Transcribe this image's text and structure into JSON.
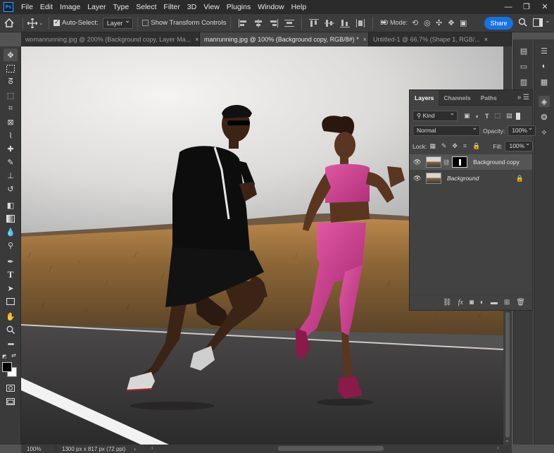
{
  "menu": {
    "logo": "Ps",
    "items": [
      "File",
      "Edit",
      "Image",
      "Layer",
      "Type",
      "Select",
      "Filter",
      "3D",
      "View",
      "Plugins",
      "Window",
      "Help"
    ],
    "window_controls": [
      "—",
      "❐",
      "✕"
    ]
  },
  "options": {
    "auto_select_label": "Auto-Select:",
    "auto_select_target": "Layer",
    "show_transform_label": "Show Transform Controls",
    "more": "•••",
    "mode_3d_label": "3D Mode:",
    "share_label": "Share"
  },
  "tabs": [
    {
      "label": "womanrunning.jpg @ 200% (Background copy, Layer Ma...",
      "close": "×"
    },
    {
      "label": "manrunning.jpg @ 100% (Background copy, RGB/8#) *",
      "close": "×"
    },
    {
      "label": "Untitled-1 @ 66.7% (Shape 1, RGB/...",
      "close": "×"
    }
  ],
  "layers_panel": {
    "tabs": [
      "Layers",
      "Channels",
      "Paths"
    ],
    "kind_label": "Kind",
    "blend_mode": "Normal",
    "opacity_label": "Opacity:",
    "opacity_value": "100%",
    "lock_label": "Lock:",
    "fill_label": "Fill:",
    "fill_value": "100%",
    "layers": [
      {
        "name": "Background copy"
      },
      {
        "name": "Background"
      }
    ]
  },
  "status": {
    "zoom": "100%",
    "doc_info": "1300 px x 817 px (72 ppi)"
  },
  "colors": {
    "share_button": "#1473e6",
    "app_bg": "#535353"
  }
}
